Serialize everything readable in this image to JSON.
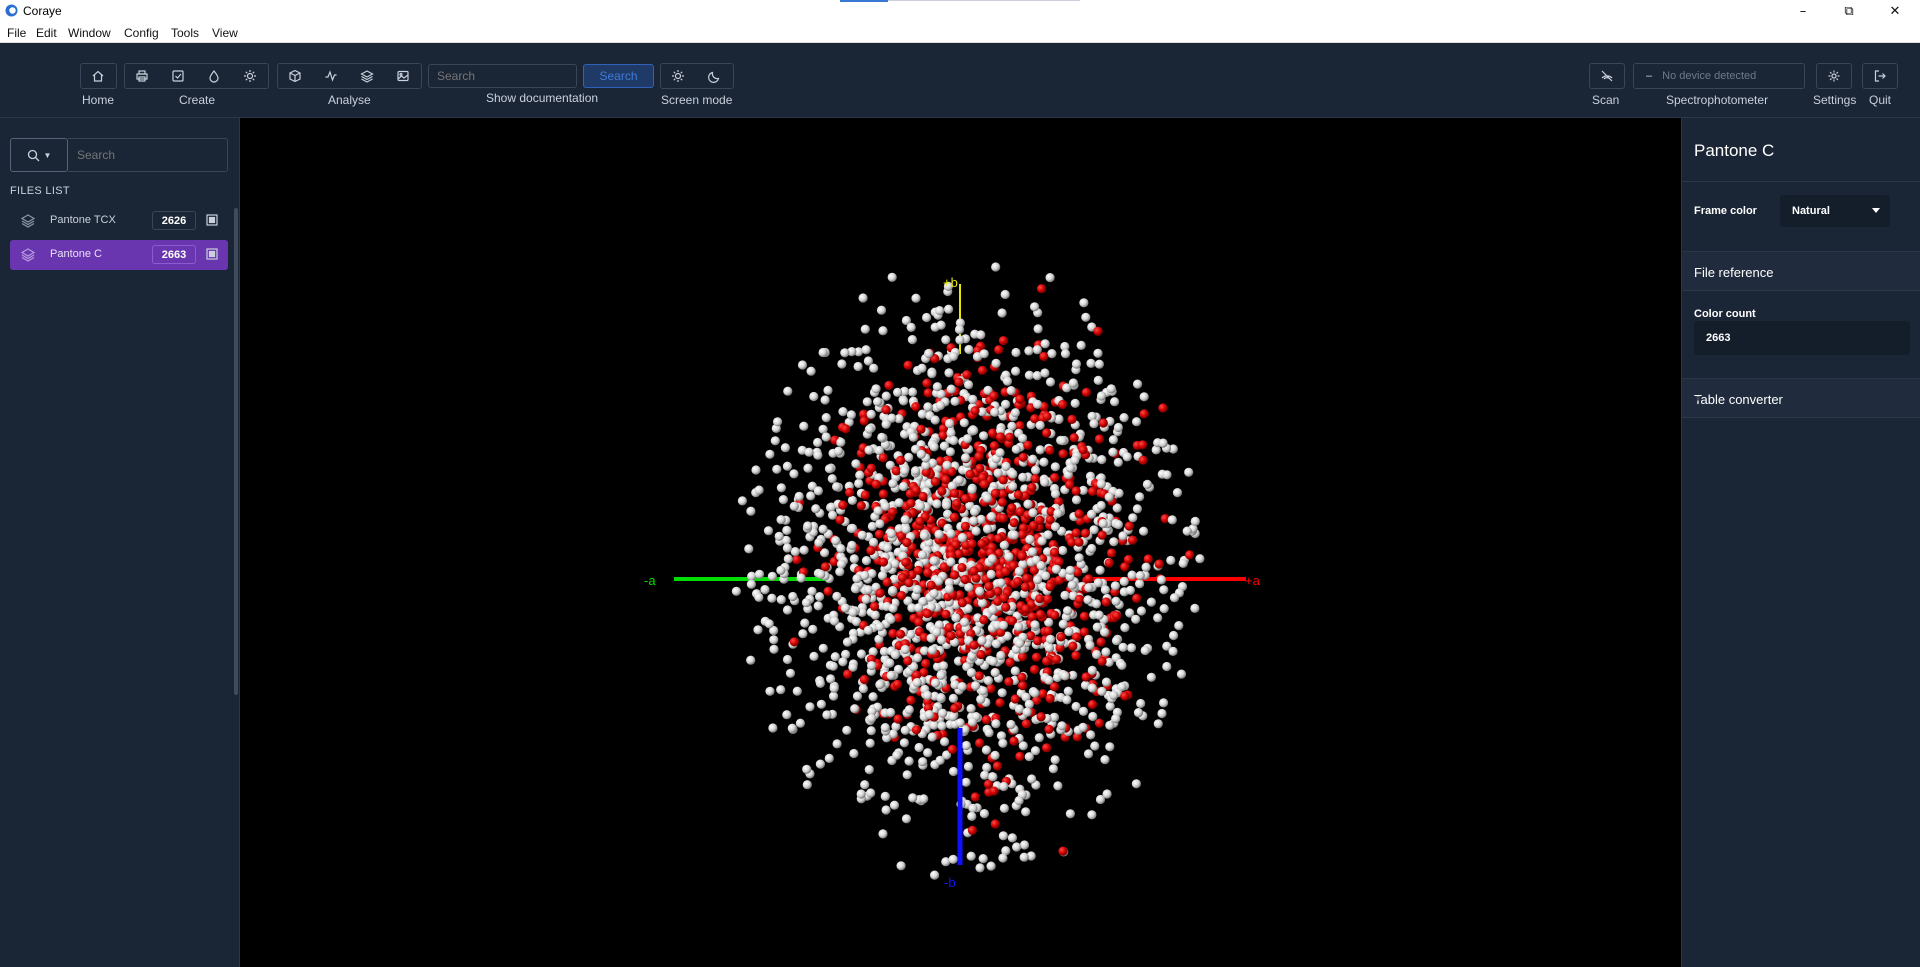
{
  "window": {
    "title": "Coraye"
  },
  "menu": [
    "File",
    "Edit",
    "Window",
    "Config",
    "Tools",
    "View"
  ],
  "toolbar": {
    "home_label": "Home",
    "create_label": "Create",
    "analyse_label": "Analyse",
    "search_placeholder": "Search",
    "search_button": "Search",
    "documentation_label": "Show documentation",
    "screen_mode_label": "Screen mode",
    "scan_label": "Scan",
    "device_status": "No device detected",
    "spectrophotometer_label": "Spectrophotometer",
    "settings_label": "Settings",
    "quit_label": "Quit"
  },
  "sidebar": {
    "search_placeholder": "Search",
    "files_title": "FILES LIST",
    "files": [
      {
        "name": "Pantone TCX",
        "count": "2626",
        "active": false
      },
      {
        "name": "Pantone C",
        "count": "2663",
        "active": true
      }
    ]
  },
  "viewport": {
    "axes": {
      "minus_a": "-a",
      "plus_a": "+a",
      "plus_b": "+b",
      "minus_b": "-b"
    },
    "colors": {
      "minus_a": "#00dd00",
      "plus_a": "#ff0000",
      "plus_b": "#e6e600",
      "minus_b": "#1010ff",
      "points_red": "#d40000",
      "points_white": "#d9d9d9"
    }
  },
  "right_panel": {
    "title": "Pantone C",
    "frame_color_label": "Frame color",
    "frame_color_value": "Natural",
    "file_reference_label": "File reference",
    "color_count_label": "Color count",
    "color_count_value": "2663",
    "table_converter_label": "Table converter"
  },
  "colors": {
    "toolbar_bg": "#1a2535",
    "accent": "#6a36b0",
    "search_accent": "#3f7ad6"
  }
}
